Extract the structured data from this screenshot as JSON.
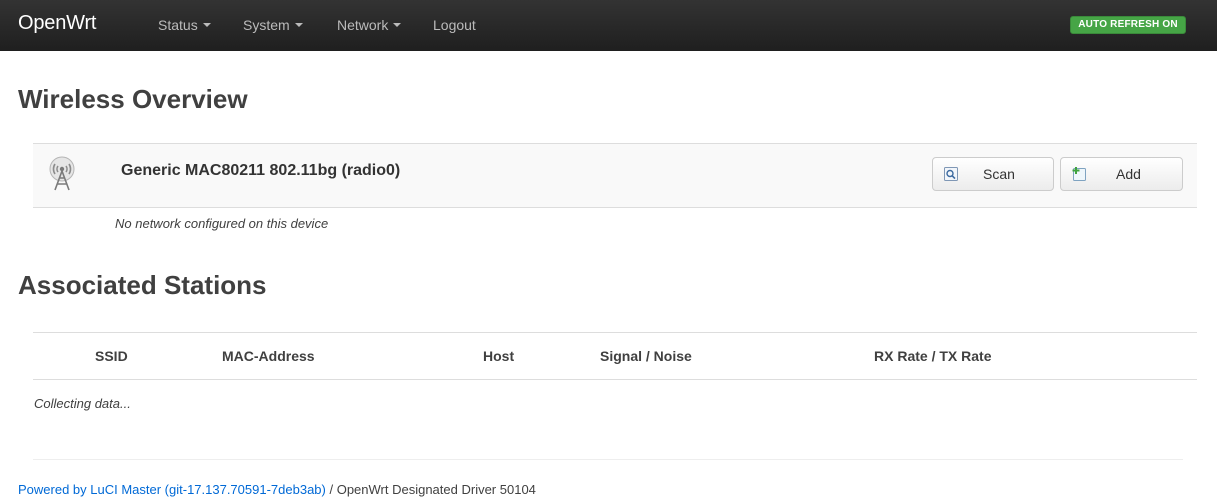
{
  "header": {
    "brand": "OpenWrt",
    "menu": [
      {
        "label": "Status",
        "dropdown": true
      },
      {
        "label": "System",
        "dropdown": true
      },
      {
        "label": "Network",
        "dropdown": true
      },
      {
        "label": "Logout",
        "dropdown": false
      }
    ],
    "refresh_badge": "AUTO REFRESH ON",
    "refresh_color": "#46a546"
  },
  "wireless": {
    "title": "Wireless Overview",
    "radio": {
      "name": "Generic MAC80211 802.11bg (radio0)",
      "icon": "wifi-antenna-icon",
      "scan_label": "Scan",
      "add_label": "Add"
    },
    "no_network": "No network configured on this device"
  },
  "stations": {
    "title": "Associated Stations",
    "columns": [
      "SSID",
      "MAC-Address",
      "Host",
      "Signal / Noise",
      "RX Rate / TX Rate"
    ],
    "status": "Collecting data..."
  },
  "footer": {
    "link_text": "Powered by LuCI Master (git-17.137.70591-7deb3ab)",
    "separator": " / ",
    "version": "OpenWrt Designated Driver 50104",
    "link_color": "#0069d6"
  }
}
